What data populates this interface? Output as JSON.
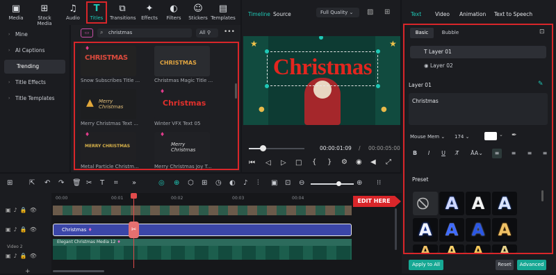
{
  "toolbar": {
    "media": "Media",
    "stock_media": "Stock Media",
    "audio": "Audio",
    "titles": "Titles",
    "transitions": "Transitions",
    "effects": "Effects",
    "filters": "Filters",
    "stickers": "Stickers",
    "templates": "Templates"
  },
  "search": {
    "value": "christmas",
    "filter": "All"
  },
  "sidebar": {
    "items": [
      {
        "label": "Mine"
      },
      {
        "label": "AI Captions"
      },
      {
        "label": "Trending"
      },
      {
        "label": "Title Effects"
      },
      {
        "label": "Title Templates"
      }
    ]
  },
  "library": {
    "items": [
      {
        "caption": "Snow Subscribes Title ...",
        "thumb": "CHRISTMAS"
      },
      {
        "caption": "Christmas Magic Title ...",
        "thumb": "CHRISTMAS"
      },
      {
        "caption": "Merry Christmas Text ...",
        "thumb": "Merry Christmas"
      },
      {
        "caption": "Winter VFX Text 05",
        "thumb": "Christmas"
      },
      {
        "caption": "Metal Particle Christm...",
        "thumb": "MERRY CHRISTMAS"
      },
      {
        "caption": "Merry Christmas Joy T...",
        "thumb": "Merry Christmas"
      }
    ]
  },
  "player": {
    "tab_timeline": "Timeline",
    "tab_source": "Source",
    "quality": "Full Quality",
    "title_text": "Christmas",
    "current_time": "00:00:01:09",
    "separator": "/",
    "total_time": "00:00:05:00"
  },
  "timeline": {
    "ruler": [
      "00:00",
      "00:01",
      "00:02",
      "00:03",
      "00:04"
    ],
    "title_clip": "Christmas",
    "media_clip": "Elegant Christmas Media 12",
    "video_label": "Video 2",
    "callout": "EDIT HERE"
  },
  "panel": {
    "tabs": [
      "Text",
      "Video",
      "Animation",
      "Text to Speech"
    ],
    "subtab_basic": "Basic",
    "subtab_bubble": "Bubble",
    "layer1": "Layer 01",
    "layer2": "Layer 02",
    "layer_heading": "Layer 01",
    "text_value": "Christmas",
    "font": "Mouse Mem",
    "size": "174",
    "preset_label": "Preset",
    "apply_all": "Apply to All",
    "reset": "Reset",
    "advanced": "Advanced"
  },
  "colors": {
    "accent": "#1fc8b6",
    "red": "#d9262a",
    "title_clip": "#3b46a8",
    "media_clip": "#2c6b5c"
  }
}
